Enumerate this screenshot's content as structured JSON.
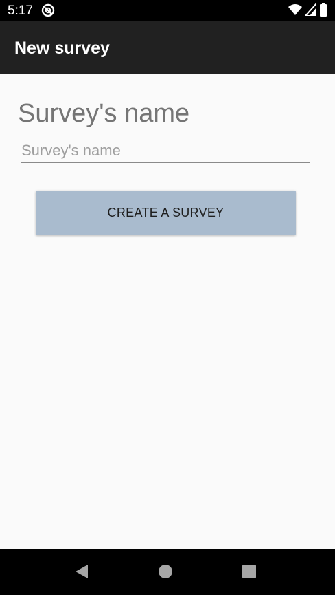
{
  "status_bar": {
    "time": "5:17",
    "icons": [
      "app-notification-icon",
      "wifi-icon",
      "signal-icon",
      "battery-icon"
    ]
  },
  "app_bar": {
    "title": "New survey"
  },
  "form": {
    "heading": "Survey's name",
    "name_input": {
      "placeholder": "Survey's name",
      "value": ""
    },
    "create_button_label": "CREATE A SURVEY"
  },
  "nav_bar": {
    "icons": [
      "back-icon",
      "home-icon",
      "recents-icon"
    ]
  },
  "colors": {
    "status_bar": "#000000",
    "app_bar": "#212121",
    "background": "#fafafa",
    "button": "#a9bbce",
    "heading_text": "#757575"
  }
}
